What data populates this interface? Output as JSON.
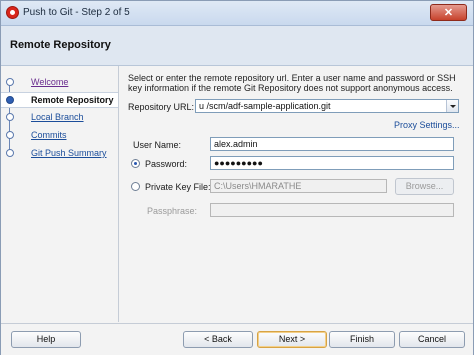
{
  "window": {
    "title": "Push to Git - Step 2 of 5"
  },
  "header": {
    "title": "Remote Repository"
  },
  "steps": [
    {
      "label": "Welcome",
      "state": "visited"
    },
    {
      "label": "Remote Repository",
      "state": "active"
    },
    {
      "label": "Local Branch",
      "state": "pending"
    },
    {
      "label": "Commits",
      "state": "pending"
    },
    {
      "label": "Git Push Summary",
      "state": "pending"
    }
  ],
  "instructions": "Select or enter the remote repository url. Enter a user name and password or SSH key information if the remote Git Repository does not support anonymous access.",
  "form": {
    "repo_url_label": "Repository URL:",
    "repo_url_value": "u                                  /scm/adf-sample-application.git",
    "proxy_link": "Proxy Settings...",
    "user_name_label": "User Name:",
    "user_name_value": "alex.admin",
    "password_label": "Password:",
    "password_value": "●●●●●●●●●",
    "private_key_label": "Private Key File:",
    "private_key_value": "C:\\Users\\HMARATHE",
    "browse_label": "Browse...",
    "passphrase_label": "Passphrase:",
    "passphrase_value": ""
  },
  "footer": {
    "help": "Help",
    "back": "< Back",
    "next": "Next >",
    "finish": "Finish",
    "cancel": "Cancel"
  },
  "colors": {
    "link": "#1b4d9a",
    "accent": "#2f5fb3",
    "close": "#c7422c"
  }
}
